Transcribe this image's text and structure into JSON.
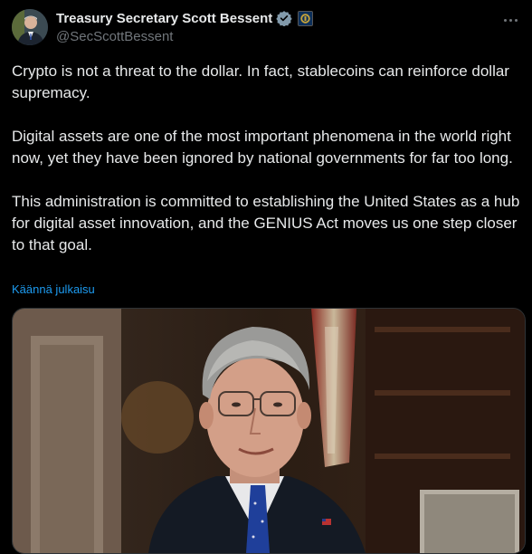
{
  "author": {
    "display_name": "Treasury Secretary Scott Bessent",
    "handle": "@SecScottBessent"
  },
  "icons": {
    "avatar": "avatar-portrait",
    "verified": "verified-badge-icon",
    "affiliation": "treasury-seal-icon",
    "more": "more-options-icon"
  },
  "colors": {
    "background": "#000000",
    "text": "#e7e9ea",
    "muted": "#71767b",
    "link": "#1d9bf0",
    "verified_badge": "#829aab"
  },
  "post": {
    "paragraphs": [
      "Crypto is not a threat to the dollar. In fact, stablecoins can reinforce dollar supremacy.",
      "Digital assets are one of the most important phenomena in the world right now, yet they have been ignored by national governments for far too long.",
      "This administration is committed to establishing the United States as a hub for digital asset innovation, and the GENIUS Act moves us one step closer to that goal."
    ],
    "translate_label": "Käännä julkaisu"
  }
}
